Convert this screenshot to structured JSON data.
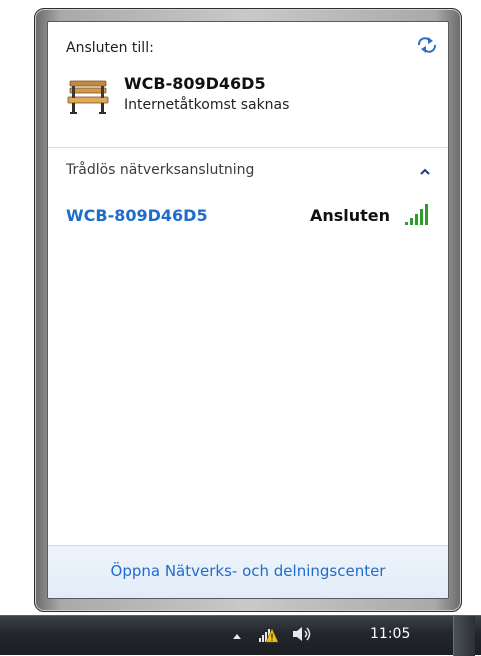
{
  "popup": {
    "connected_label": "Ansluten till:",
    "connected_network": {
      "name": "WCB-809D46D5",
      "status": "Internetåtkomst saknas",
      "icon": "bench-icon"
    },
    "refresh_icon": "refresh-icon",
    "wireless_section": {
      "header": "Trådlös nätverksanslutning",
      "networks": [
        {
          "name": "WCB-809D46D5",
          "status": "Ansluten",
          "signal_bars": 5
        }
      ]
    },
    "footer_link": "Öppna Nätverks- och delningscenter"
  },
  "taskbar": {
    "clock": "11:05",
    "icons": [
      "show-hidden-icons-arrow",
      "network-warning-icon",
      "volume-icon"
    ]
  },
  "colors": {
    "link": "#1f6ccc",
    "signal": "#2f9b2f",
    "warning": "#f4c20d"
  }
}
